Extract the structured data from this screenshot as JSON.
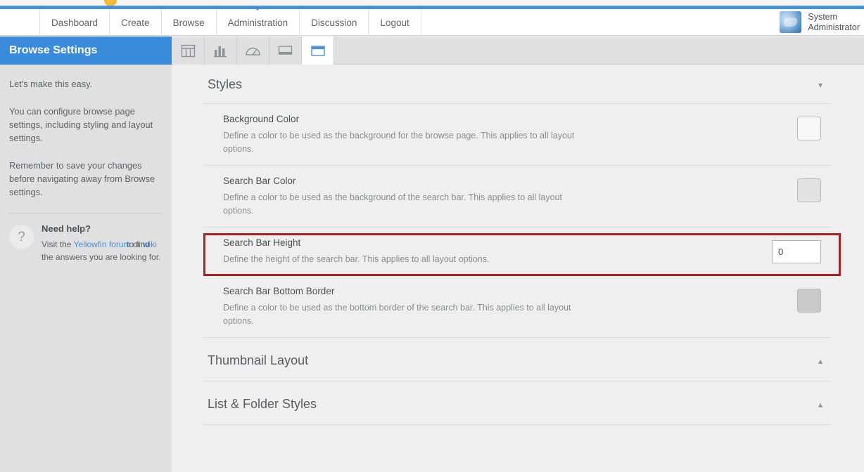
{
  "header": {
    "nav_items": [
      {
        "label": "Dashboard",
        "active": false
      },
      {
        "label": "Create",
        "active": false
      },
      {
        "label": "Browse",
        "active": false
      },
      {
        "label": "Administration",
        "active": true
      },
      {
        "label": "Discussion",
        "active": false
      },
      {
        "label": "Logout",
        "active": false
      }
    ],
    "user": {
      "first_line": "System",
      "second_line": "Administrator",
      "avatar_icon": "user-avatar-image"
    },
    "brand_blue": "#4a90d9",
    "logo_icon": "yellowfin-logo-partial"
  },
  "toolbar": {
    "page_title": "Browse Settings",
    "title_bg": "#3b8bdd",
    "tabs": [
      {
        "name": "report-settings-tab",
        "icon": "table-grid-icon",
        "active": false
      },
      {
        "name": "chart-settings-tab",
        "icon": "bar-chart-icon",
        "active": false
      },
      {
        "name": "dashboard-settings-tab",
        "icon": "gauge-icon",
        "active": false
      },
      {
        "name": "storyboard-settings-tab",
        "icon": "presentation-icon",
        "active": false
      },
      {
        "name": "browse-settings-tab",
        "icon": "browser-window-icon",
        "active": true
      }
    ]
  },
  "sidebar": {
    "paragraphs": [
      "Let's make this easy.",
      "You can configure browse page settings, including styling and layout settings.",
      "Remember to save your changes before navigating away from Browse settings."
    ],
    "help": {
      "icon": "question-mark-icon",
      "icon_glyph": "?",
      "title": "Need help?",
      "text_before": "Visit the ",
      "link_forum": "Yellowfin forum",
      "text_middle": " or ",
      "link_wiki": "wiki",
      "text_after": " to find the answers you are looking for.",
      "link_color": "#4a90d9"
    }
  },
  "main": {
    "sections": [
      {
        "title": "Styles",
        "expanded": true,
        "chevron": "chevron-down-icon",
        "chevron_glyph": "▾",
        "rows": [
          {
            "label": "Background Color",
            "description": "Define a color to be used as the background for the browse page. This applies to all layout options.",
            "control_type": "color-swatch",
            "control_name": "background-color-swatch",
            "swatch_color": "#f7f7f7"
          },
          {
            "label": "Search Bar Color",
            "description": "Define a color to be used as the background of the search bar. This applies to all layout options.",
            "control_type": "color-swatch",
            "control_name": "search-bar-color-swatch",
            "swatch_color": "#e2e2e2"
          },
          {
            "label": "Search Bar Height",
            "description": "Define the height of the search bar. This applies to all layout options.",
            "control_type": "number-input",
            "control_name": "search-bar-height-input",
            "value": "0",
            "highlighted": true,
            "highlight_color": "#b02020"
          },
          {
            "label": "Search Bar Bottom Border",
            "description": "Define a color to be used as the bottom border of the search bar. This applies to all layout options.",
            "control_type": "color-swatch",
            "control_name": "search-bar-bottom-border-swatch",
            "swatch_color": "#c9c9c9"
          }
        ]
      },
      {
        "title": "Thumbnail Layout",
        "expanded": false,
        "chevron": "chevron-up-icon",
        "chevron_glyph": "▴",
        "rows": []
      },
      {
        "title": "List & Folder Styles",
        "expanded": false,
        "chevron": "chevron-up-icon",
        "chevron_glyph": "▴",
        "rows": []
      }
    ]
  }
}
